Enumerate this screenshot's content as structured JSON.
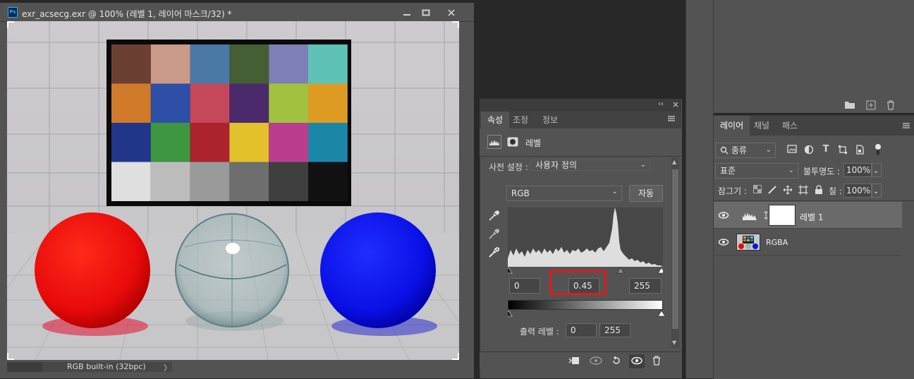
{
  "document": {
    "app_icon": "Ps",
    "title": "exr_acsecg.exr @ 100% (레벨 1, 레이어 마스크/32) *",
    "minimize_icon": "minimize-icon",
    "restore_icon": "restore-icon",
    "close_icon": "close-icon",
    "status_text": "RGB built-in (32bpc)",
    "status_arrow": "〉"
  },
  "properties_panel": {
    "collapse_glyph": "‹‹",
    "close_glyph": "×",
    "tabs": [
      "속성",
      "조정",
      "정보"
    ],
    "active_tab": "속성",
    "header_label": "레벨",
    "preset_label": "사전 설정 :",
    "preset_value": "사용자 정의",
    "channel_value": "RGB",
    "auto_button": "자동",
    "input_black": "0",
    "input_gamma": "0.45",
    "input_white": "255",
    "output_label": "출력 레벨 :",
    "output_black": "0",
    "output_white": "255",
    "highlight_color": "#e0191b"
  },
  "layers_panel": {
    "tabs": [
      "레이어",
      "채널",
      "패스"
    ],
    "active_tab": "레이어",
    "filter_label": "종류",
    "blend_mode": "표준",
    "opacity_label": "불투명도 :",
    "opacity_value": "100%",
    "lock_label": "잠그기 :",
    "fill_label": "칠 :",
    "fill_value": "100%",
    "layers": [
      {
        "name": "레벨 1",
        "selected": true
      },
      {
        "name": "RGBA",
        "selected": false
      }
    ]
  },
  "swatch_colors": [
    [
      "#6b4032",
      "#c89a87",
      "#4a79a6",
      "#455e33",
      "#7e7fb6",
      "#5ec2b6"
    ],
    [
      "#d17a2a",
      "#2d4fa6",
      "#c4475a",
      "#4a2a6a",
      "#a2c13e",
      "#de9b24"
    ],
    [
      "#20368b",
      "#3f9641",
      "#ac232e",
      "#e3c12b",
      "#bb3e8e",
      "#1b87a8"
    ],
    [
      "#dfdfdf",
      "#bcbcbc",
      "#9a9a9a",
      "#6e6e6e",
      "#3f3f3f",
      "#111111"
    ]
  ]
}
